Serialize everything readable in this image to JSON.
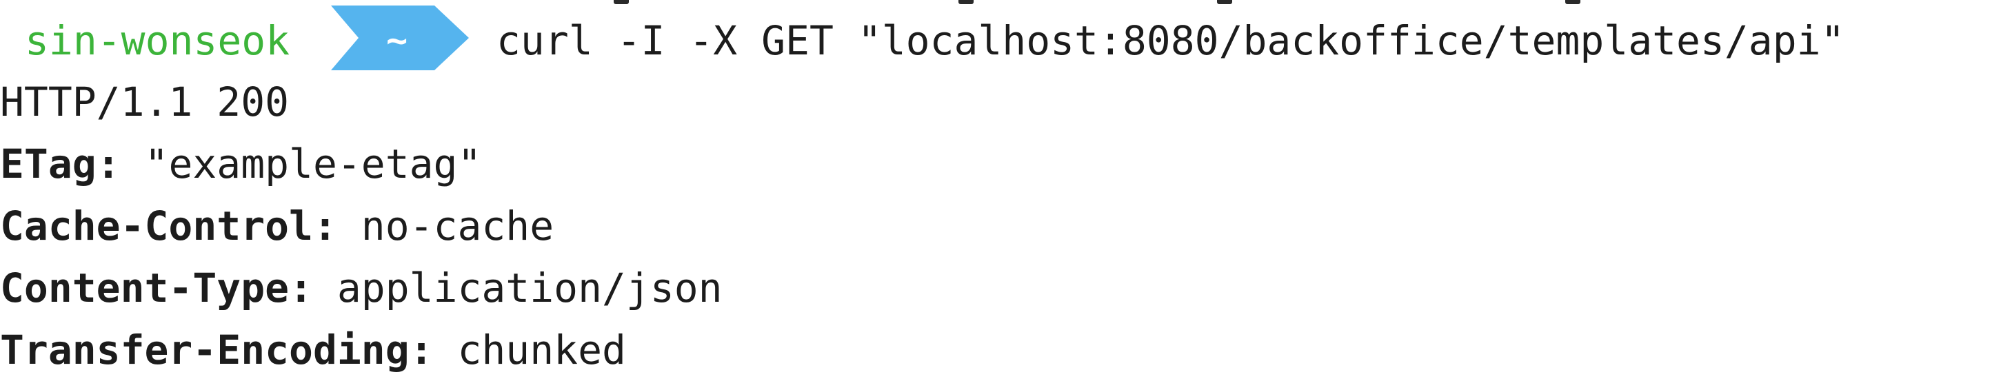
{
  "prompt": {
    "user": "sin-wonseok",
    "directory": "~",
    "command": "curl -I -X GET \"localhost:8080/backoffice/templates/api\""
  },
  "response": {
    "status_line": "HTTP/1.1 200",
    "headers": [
      {
        "name": "ETag:",
        "value": "\"example-etag\""
      },
      {
        "name": "Cache-Control:",
        "value": "no-cache"
      },
      {
        "name": "Content-Type:",
        "value": "application/json"
      },
      {
        "name": "Transfer-Encoding:",
        "value": "chunked"
      }
    ]
  },
  "colors": {
    "prompt_user": "#3cb43a",
    "prompt_segment": "#55b4ee",
    "text": "#1c1c1c",
    "background": "#ffffff"
  }
}
